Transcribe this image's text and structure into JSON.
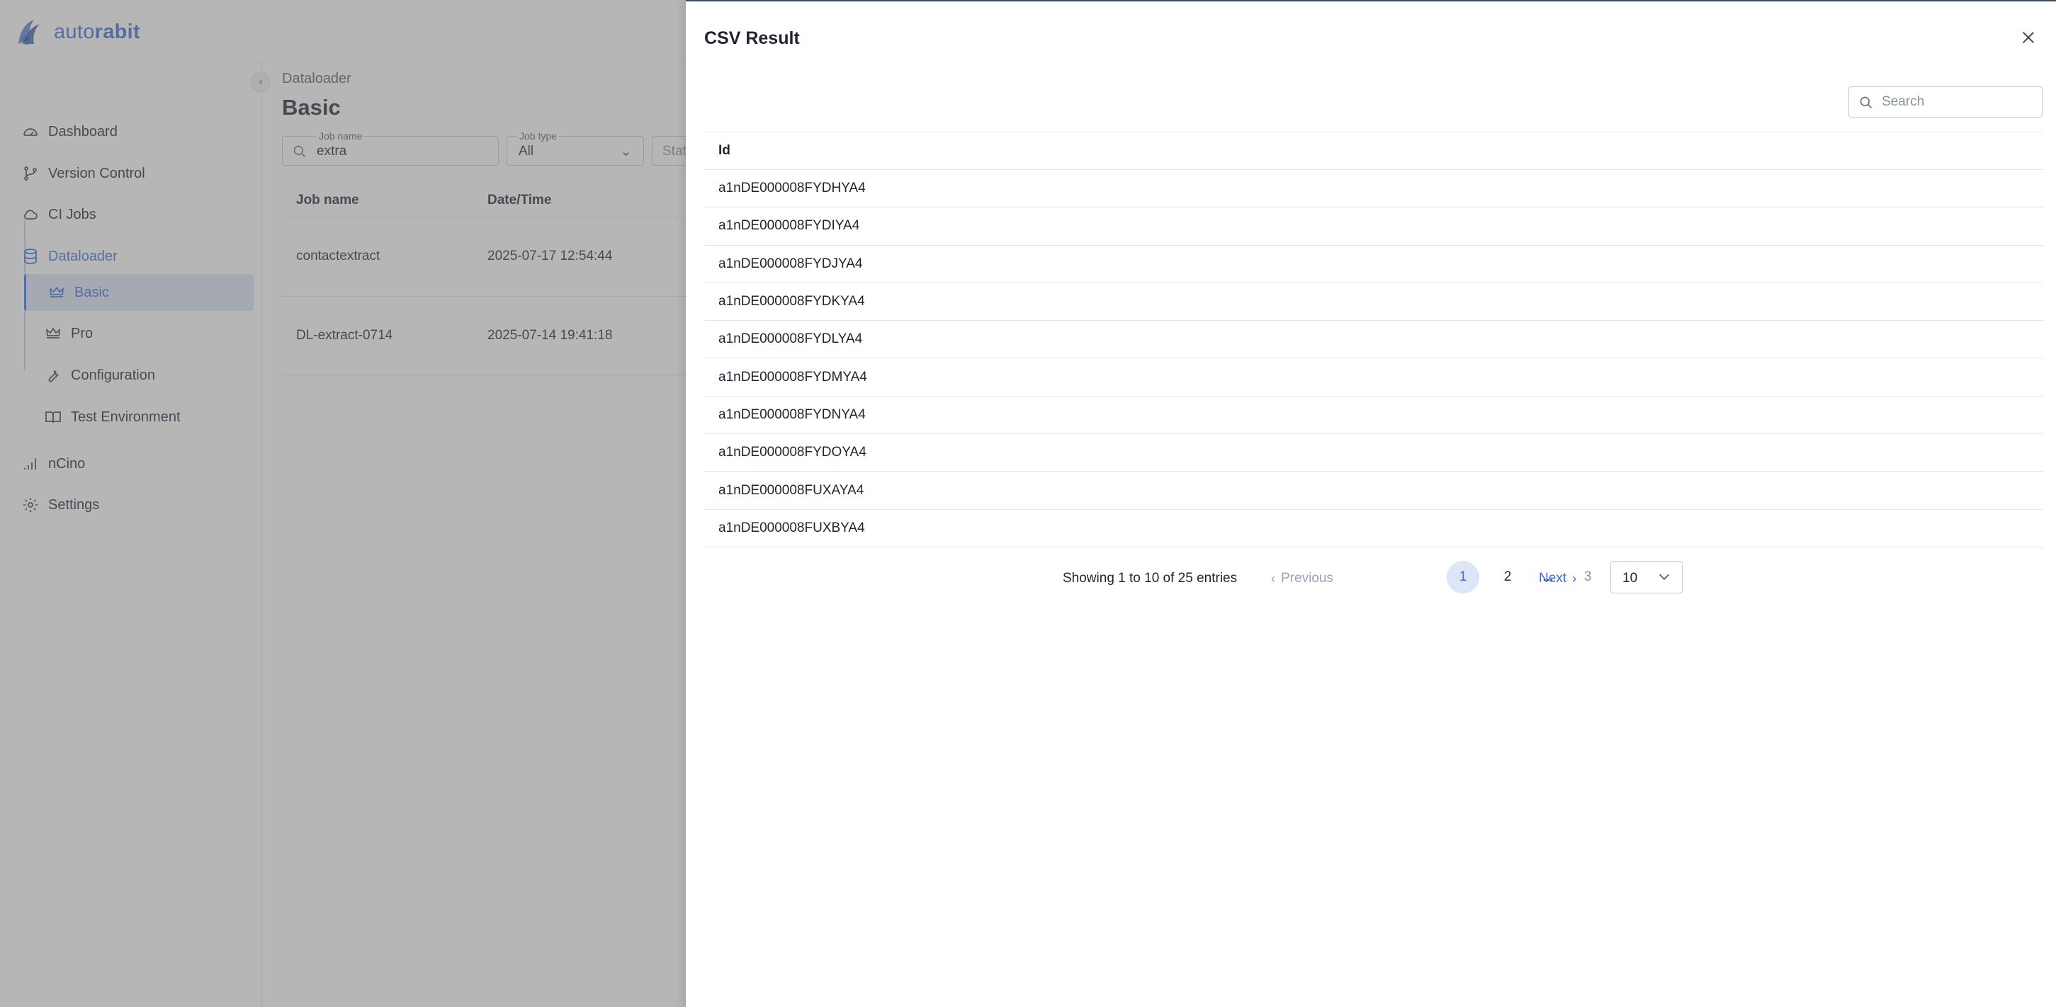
{
  "app": {
    "brand_prefix": "auto",
    "brand_suffix": "rabit"
  },
  "sidebar": {
    "items": [
      {
        "label": "Dashboard",
        "icon": "dashboard-gauge-icon"
      },
      {
        "label": "Version Control",
        "icon": "git-branch-icon"
      },
      {
        "label": "CI Jobs",
        "icon": "cloud-icon"
      },
      {
        "label": "Dataloader",
        "icon": "database-icon",
        "state": "active-parent"
      },
      {
        "label": "Basic",
        "icon": "crown-icon",
        "state": "selected"
      },
      {
        "label": "Pro",
        "icon": "crown-icon"
      },
      {
        "label": "Configuration",
        "icon": "wrench-icon"
      },
      {
        "label": "Test Environment",
        "icon": "book-icon"
      },
      {
        "label": "nCino",
        "icon": "signal-bars-icon"
      },
      {
        "label": "Settings",
        "icon": "gear-icon"
      }
    ]
  },
  "main": {
    "breadcrumb": "Dataloader",
    "title": "Basic",
    "filters": {
      "job_name_label": "Job name",
      "job_name_value": "extra",
      "job_type_label": "Job type",
      "job_type_value": "All",
      "status_partial": "Stat"
    },
    "table": {
      "columns": [
        "Job name",
        "Date/Time"
      ],
      "rows": [
        {
          "job_name": "contactextract",
          "datetime": "2025-07-17 12:54:44"
        },
        {
          "job_name": "DL-extract-0714",
          "datetime": "2025-07-14 19:41:18"
        }
      ]
    }
  },
  "drawer": {
    "title": "CSV Result",
    "search_placeholder": "Search",
    "column": "Id",
    "rows": [
      "a1nDE000008FYDHYA4",
      "a1nDE000008FYDIYA4",
      "a1nDE000008FYDJYA4",
      "a1nDE000008FYDKYA4",
      "a1nDE000008FYDLYA4",
      "a1nDE000008FYDMYA4",
      "a1nDE000008FYDNYA4",
      "a1nDE000008FYDOYA4",
      "a1nDE000008FUXAYA4",
      "a1nDE000008FUXBYA4"
    ],
    "pagination": {
      "info": "Showing 1 to 10 of 25 entries",
      "previous": "Previous",
      "next": "Next",
      "pages": [
        "1",
        "2",
        "...",
        "3"
      ],
      "current_page": "1",
      "page_size": "10"
    }
  },
  "colors": {
    "accent": "#3a6fd8",
    "selected_bg": "#dde6f6",
    "overlay": "rgba(110,110,110,0.5)"
  }
}
